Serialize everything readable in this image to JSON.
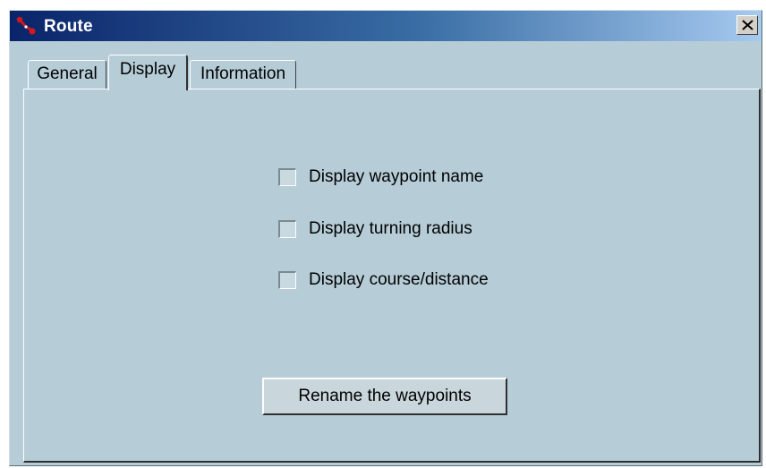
{
  "window": {
    "title": "Route",
    "app_icon": "route-icon",
    "close_glyph": "×"
  },
  "tabs": [
    {
      "label": "General",
      "selected": false
    },
    {
      "label": "Display",
      "selected": true
    },
    {
      "label": "Information",
      "selected": false
    }
  ],
  "display_options": [
    {
      "label": "Display waypoint name",
      "checked": false
    },
    {
      "label": "Display turning radius",
      "checked": false
    },
    {
      "label": "Display course/distance",
      "checked": false
    }
  ],
  "rename_button": {
    "label": "Rename the waypoints"
  },
  "colors": {
    "title_start": "#0a246a",
    "title_end": "#a6caf0",
    "panel_bg": "#b6cdd8",
    "icon_red": "#d0181e"
  }
}
